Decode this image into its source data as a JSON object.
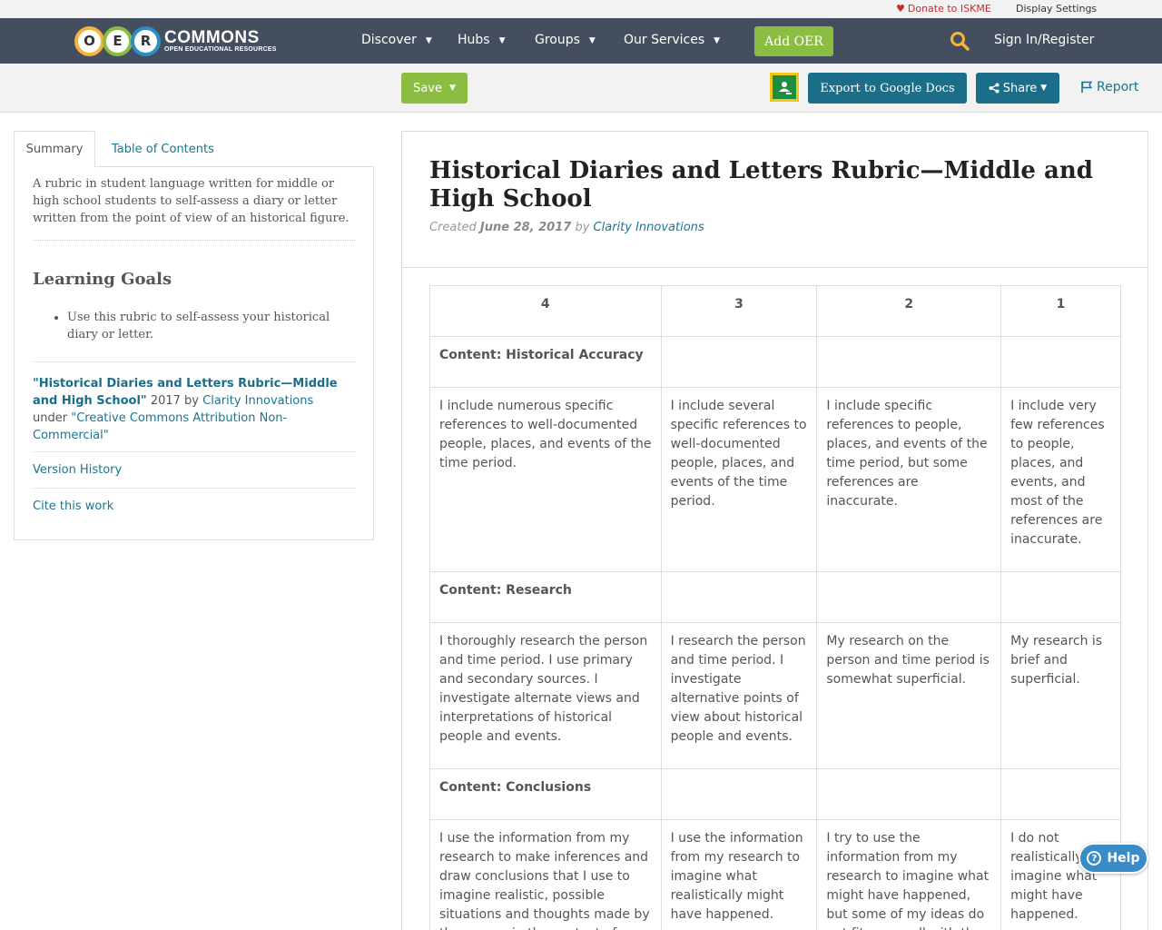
{
  "utility": {
    "donate": "Donate to ISKME",
    "display_settings": "Display Settings"
  },
  "logo": {
    "letters": [
      "O",
      "E",
      "R"
    ],
    "word": "COMMONS",
    "tagline": "OPEN EDUCATIONAL RESOURCES"
  },
  "nav": {
    "items": [
      {
        "label": "Discover"
      },
      {
        "label": "Hubs"
      },
      {
        "label": "Groups"
      },
      {
        "label": "Our Services"
      }
    ],
    "add_oer": "Add OER",
    "sign_in": "Sign In/Register"
  },
  "toolbar": {
    "save": "Save",
    "export": "Export to Google Docs",
    "share": "Share",
    "report": "Report"
  },
  "sidebar": {
    "tabs": [
      "Summary",
      "Table of Contents"
    ],
    "summary": "A rubric in student language written for middle or high school students to self-assess a diary or letter written from the point of view of an historical figure.",
    "learning_goals_heading": "Learning Goals",
    "learning_goals": [
      "Use this rubric to self-assess your historical diary or letter."
    ],
    "attribution": {
      "title": "\"Historical Diaries and Letters Rubric—Middle and High School\"",
      "year_by": " 2017 by ",
      "author": "Clarity Innovations",
      "under": "under ",
      "license": "\"Creative Commons Attribution Non-Commercial\""
    },
    "version_history": "Version History",
    "cite": "Cite this work"
  },
  "resource": {
    "title": "Historical Diaries and Letters Rubric—Middle and High School",
    "created_label": "Created",
    "date": "June 28, 2017",
    "by_label": "by",
    "author": "Clarity Innovations"
  },
  "rubric": {
    "headers": [
      "4",
      "3",
      "2",
      "1"
    ],
    "sections": [
      {
        "category": "Content: Historical Accuracy",
        "cells": [
          "I include numerous specific references to well-documented people, places, and events of the time period.",
          "I include several specific references to well-documented people, places, and events of the time period.",
          "I include specific references to people, places, and events of the time period, but some references are inaccurate.",
          "I include very few references to people, places, and events, and most of the references are inaccurate."
        ]
      },
      {
        "category": "Content: Research",
        "cells": [
          "I thoroughly research the person and time period. I use primary and secondary sources. I investigate alternate views and interpretations of historical people and events.",
          "I research the person and time period. I investigate alternative points of view about historical people and events.",
          "My research on the person and time period is somewhat superficial.",
          "My research is brief and superficial."
        ]
      },
      {
        "category": "Content: Conclusions",
        "cells": [
          "I use the information from my research to make inferences and draw conclusions that I use to imagine realistic, possible situations and thoughts made by the person in the context of",
          "I use the information from my research to imagine what realistically might have happened.",
          "I try to use the information from my research to imagine what might have happened, but some of my ideas do not fit very well with the person and period.",
          "I do not realistically imagine what might have happened."
        ]
      }
    ]
  },
  "help": {
    "label": "Help"
  },
  "colors": {
    "nav_bg": "#454e5f",
    "accent_green": "#8bbd42",
    "accent_teal": "#1b6e8a",
    "link": "#1b7591",
    "donate_red": "#c72a2a"
  }
}
